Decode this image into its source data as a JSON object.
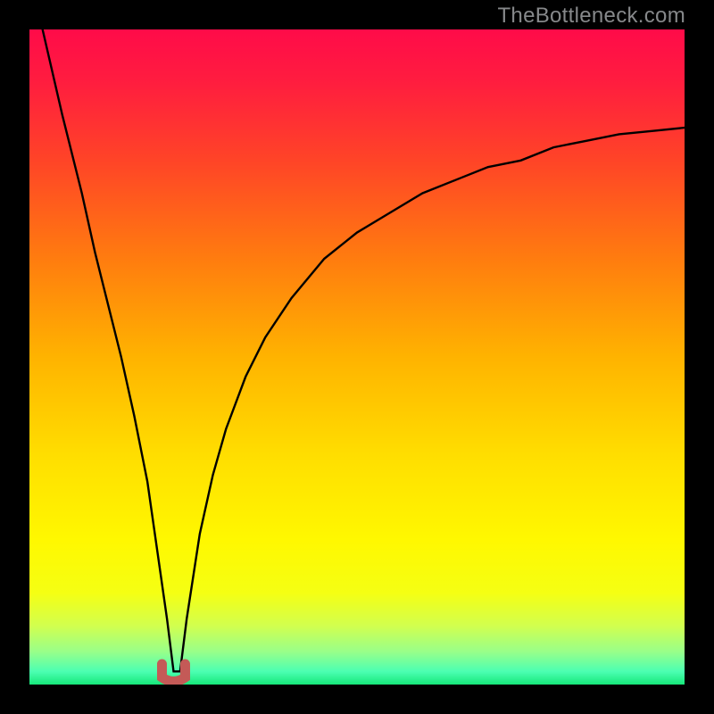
{
  "watermark": {
    "text": "TheBottleneck.com"
  },
  "colors": {
    "black": "#000000",
    "curve": "#000000",
    "u_marker": "#c45a57",
    "wm": "#86888a"
  },
  "chart_data": {
    "type": "line",
    "title": "",
    "xlabel": "",
    "ylabel": "",
    "xlim": [
      0,
      100
    ],
    "ylim": [
      0,
      100
    ],
    "grid": false,
    "note": "Background is a vertical gradient from red (top) through yellow to green (bottom). Curve shows a bottleneck pattern: a steep left branch falling to ~0 at x≈22, then rising toward an asymptote near y≈85 on the right. A small red U-shaped marker highlights the minimum. Y values estimated from pixel position, origin bottom-left.",
    "series": [
      {
        "name": "bottleneck-curve",
        "x": [
          2,
          5,
          8,
          10,
          12,
          14,
          16,
          18,
          20,
          21,
          22,
          23,
          24,
          26,
          28,
          30,
          33,
          36,
          40,
          45,
          50,
          55,
          60,
          65,
          70,
          75,
          80,
          85,
          90,
          95,
          100
        ],
        "y": [
          100,
          87,
          75,
          66,
          58,
          50,
          41,
          31,
          17,
          10,
          2,
          2,
          10,
          23,
          32,
          39,
          47,
          53,
          59,
          65,
          69,
          72,
          75,
          77,
          79,
          80,
          82,
          83,
          84,
          84.5,
          85
        ]
      }
    ],
    "marker": {
      "name": "u-minimum",
      "shape": "U",
      "x": 22,
      "y": 1.5,
      "color": "#c45a57"
    },
    "gradient_stops": [
      {
        "offset": 0.0,
        "color": "#ff0b49"
      },
      {
        "offset": 0.08,
        "color": "#ff1d3f"
      },
      {
        "offset": 0.2,
        "color": "#ff4427"
      },
      {
        "offset": 0.35,
        "color": "#ff7c0f"
      },
      {
        "offset": 0.5,
        "color": "#ffb300"
      },
      {
        "offset": 0.65,
        "color": "#ffde00"
      },
      {
        "offset": 0.78,
        "color": "#fff800"
      },
      {
        "offset": 0.86,
        "color": "#f5ff13"
      },
      {
        "offset": 0.91,
        "color": "#d2ff4e"
      },
      {
        "offset": 0.95,
        "color": "#98ff8a"
      },
      {
        "offset": 0.98,
        "color": "#4cffb2"
      },
      {
        "offset": 1.0,
        "color": "#16e87a"
      }
    ]
  }
}
